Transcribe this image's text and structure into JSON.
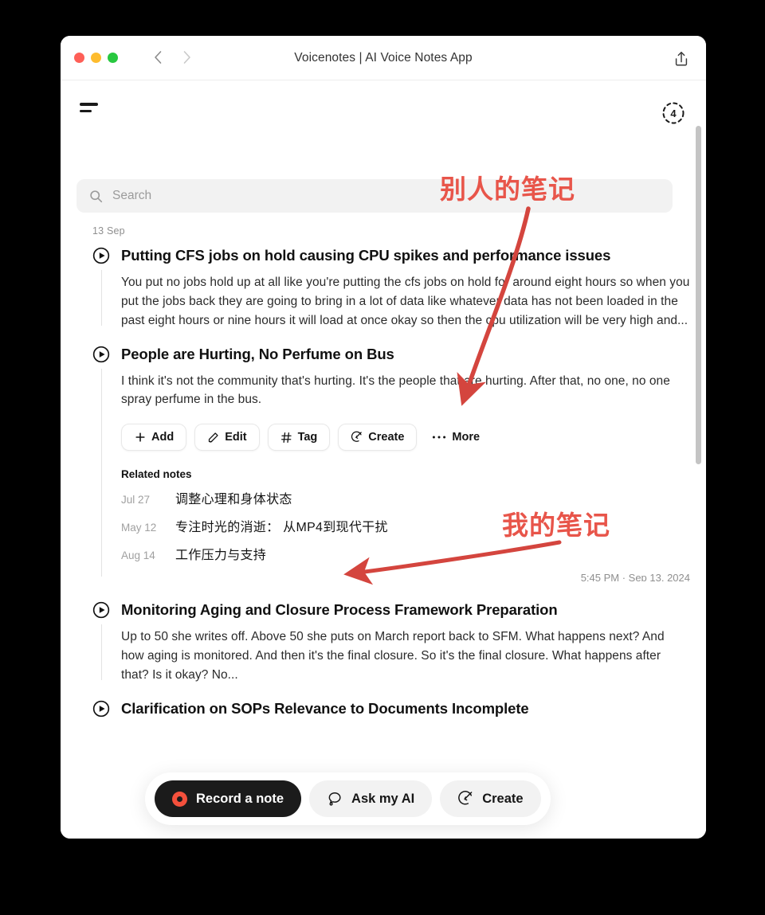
{
  "window": {
    "title": "Voicenotes | AI Voice Notes App",
    "traffic_lights": [
      "close",
      "minimize",
      "zoom"
    ],
    "back_icon": "chevron-left-icon",
    "forward_icon": "chevron-right-icon",
    "share_icon": "share-icon",
    "colors": {
      "close": "#fe5f57",
      "minimize": "#febc2e",
      "zoom": "#28c840"
    }
  },
  "app": {
    "menu_icon": "hamburger-menu-icon",
    "streak": {
      "value": "4",
      "icon": "dashed-circle-badge"
    },
    "search": {
      "value": "",
      "placeholder": "Search",
      "icon": "search-icon"
    },
    "day_label": "13 Sep",
    "notes": [
      {
        "title": "Putting CFS jobs on hold causing CPU spikes and performance issues",
        "body": "You put no jobs hold up at all like you're putting the cfs jobs on hold for around eight hours so when you put the jobs back they are going to bring in a lot of data like whatever data has not been loaded in the past eight hours or nine hours it will load at once okay so then the cpu utilization will be very high and...",
        "play_icon": "play-circle-icon"
      },
      {
        "title": "People are Hurting, No Perfume on Bus",
        "body": "I think it's not the community that's hurting. It's the people that are hurting. After that, no one, no one spray perfume in the bus.",
        "play_icon": "play-circle-icon",
        "chips": [
          {
            "label": "Add",
            "icon": "plus-icon"
          },
          {
            "label": "Edit",
            "icon": "pencil-icon"
          },
          {
            "label": "Tag",
            "icon": "hash-icon"
          },
          {
            "label": "Create",
            "icon": "magic-wand-icon"
          },
          {
            "label": "More",
            "icon": "ellipsis-icon"
          }
        ],
        "related_title": "Related notes",
        "related": [
          {
            "date": "Jul 27",
            "name": "调整心理和身体状态"
          },
          {
            "date": "May 12",
            "name": "专注时光的消逝： 从MP4到现代干扰"
          },
          {
            "date": "Aug 14",
            "name": "工作压力与支持"
          }
        ],
        "timestamp": "5:45 PM · Sep 13, 2024"
      },
      {
        "title": "Monitoring Aging and Closure Process Framework Preparation",
        "body": "Up to 50 she writes off. Above 50 she puts on March report back to SFM. What happens next? And how aging is monitored. And then it's the final closure. So it's the final closure. What happens after that? Is it okay? No...",
        "play_icon": "play-circle-icon"
      },
      {
        "title": "Clarification on SOPs Relevance to Documents Incomplete",
        "body": "",
        "play_icon": "play-circle-icon"
      }
    ],
    "action_bar": [
      {
        "label": "Record a note",
        "icon": "record-dot-icon",
        "style": "primary"
      },
      {
        "label": "Ask my AI",
        "icon": "chat-bubble-icon",
        "style": "ghost"
      },
      {
        "label": "Create",
        "icon": "magic-wand-icon",
        "style": "ghost"
      }
    ]
  },
  "annotations": {
    "accent_color": "#e8554a",
    "labels": [
      {
        "text": "别人的笔记",
        "points_to": "note-1-body"
      },
      {
        "text": "我的笔记",
        "points_to": "related-notes-list"
      }
    ]
  }
}
